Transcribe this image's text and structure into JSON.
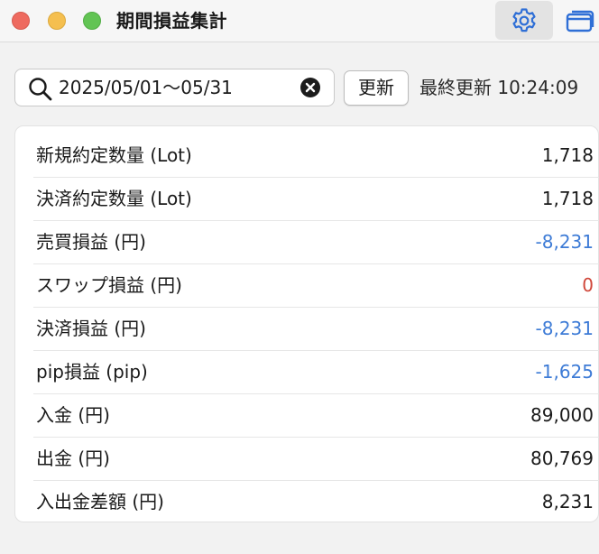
{
  "window": {
    "title": "期間損益集計"
  },
  "toolbar": {
    "settings_icon": "gear-icon",
    "window_icon": "windows-icon"
  },
  "search": {
    "value": "2025/05/01〜05/31",
    "search_icon": "search-icon",
    "clear_icon": "clear-icon"
  },
  "refresh": {
    "label": "更新"
  },
  "last_updated": {
    "text": "最終更新 10:24:09"
  },
  "colors": {
    "negative": "#3d7bd6",
    "zero": "#d0473a",
    "default": "#1a1a1a"
  },
  "summary": {
    "rows": [
      {
        "label": "新規約定数量 (Lot)",
        "value": "1,718"
      },
      {
        "label": "決済約定数量 (Lot)",
        "value": "1,718"
      },
      {
        "label": "売買損益 (円)",
        "value": "-8,231"
      },
      {
        "label": "スワップ損益 (円)",
        "value": "0"
      },
      {
        "label": "決済損益 (円)",
        "value": "-8,231"
      },
      {
        "label": "pip損益 (pip)",
        "value": "-1,625"
      },
      {
        "label": "入金 (円)",
        "value": "89,000"
      },
      {
        "label": "出金 (円)",
        "value": "80,769"
      },
      {
        "label": "入出金差額 (円)",
        "value": "8,231"
      }
    ]
  }
}
